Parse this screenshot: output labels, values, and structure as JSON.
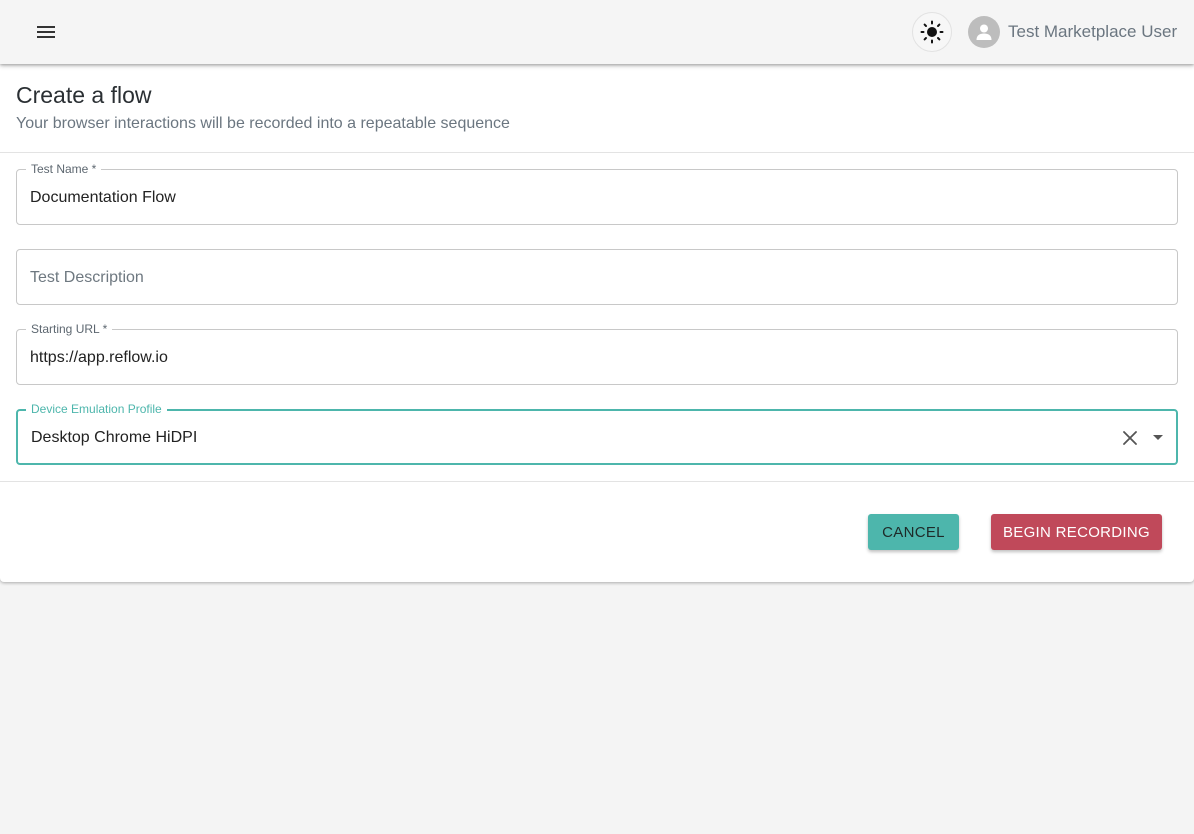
{
  "header": {
    "menu_icon": "hamburger-menu-icon",
    "theme_icon": "sun-icon",
    "user_icon": "person-icon",
    "user_name": "Test Marketplace User"
  },
  "form": {
    "title": "Create a flow",
    "subtitle": "Your browser interactions will be recorded into a repeatable sequence",
    "fields": {
      "test_name": {
        "label": "Test Name *",
        "value": "Documentation Flow"
      },
      "test_description": {
        "placeholder": "Test Description",
        "value": ""
      },
      "starting_url": {
        "label": "Starting URL *",
        "value": "https://app.reflow.io"
      },
      "device_profile": {
        "label": "Device Emulation Profile",
        "value": "Desktop Chrome HiDPI",
        "clear_icon": "close-icon",
        "dropdown_icon": "caret-down-icon"
      }
    },
    "actions": {
      "cancel_label": "CANCEL",
      "record_label": "BEGIN RECORDING"
    }
  },
  "colors": {
    "accent": "#4db6ac",
    "danger": "#c0495a",
    "background": "#f4f4f4"
  }
}
